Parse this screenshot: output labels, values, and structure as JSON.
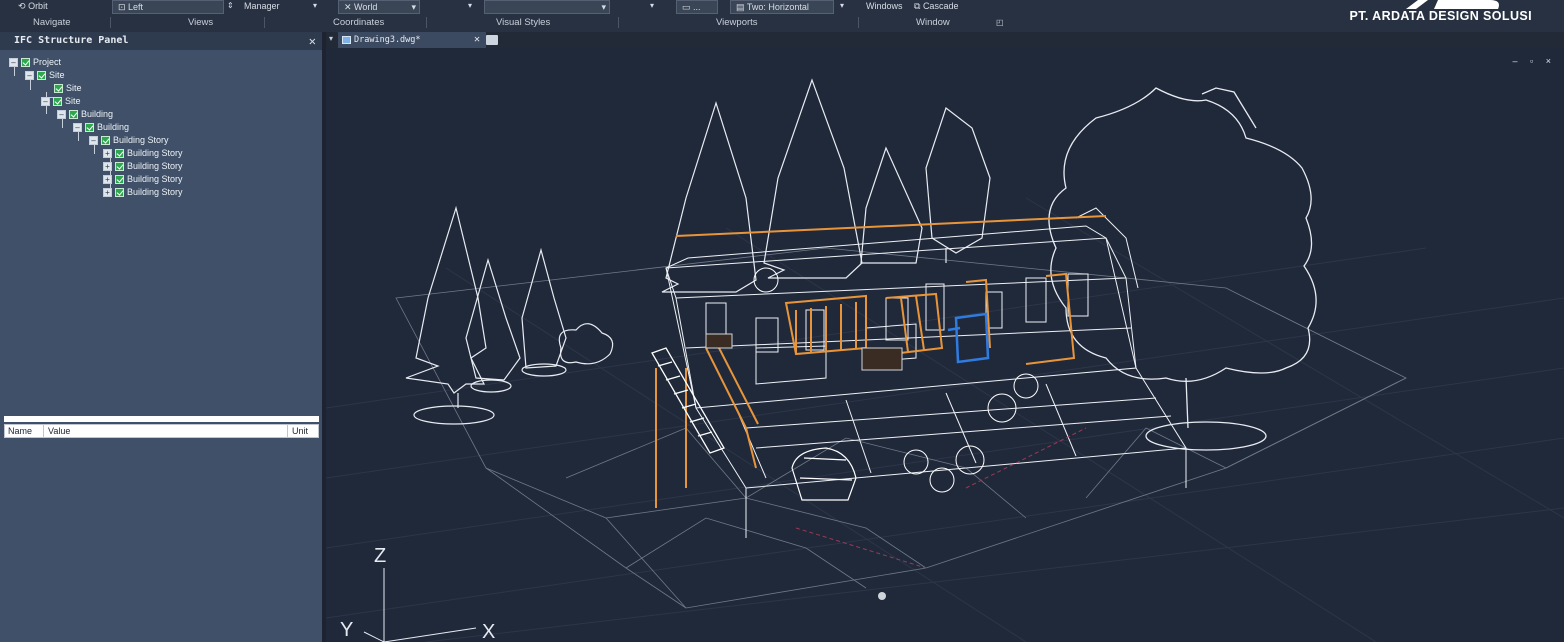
{
  "ribbon": {
    "orbit_label": "Orbit",
    "view_select": "Left",
    "manager_label": "Manager",
    "coord_select": "World",
    "visual_style_select": "",
    "viewport_btn": "...",
    "viewport_config": "Two: Horizontal",
    "windows_label": "Windows",
    "cascade_label": "Cascade",
    "groups": [
      "Navigate",
      "Views",
      "Coordinates",
      "Visual Styles",
      "Viewports",
      "Window"
    ]
  },
  "brand": {
    "name": "PT. ARDATA DESIGN SOLUSI"
  },
  "ifc_panel": {
    "title": "IFC Structure Panel",
    "tree": [
      {
        "label": "Project",
        "level": 0,
        "expander": "minus"
      },
      {
        "label": "Site",
        "level": 1,
        "expander": "minus"
      },
      {
        "label": "Site",
        "level": 2,
        "expander": "none"
      },
      {
        "label": "Site",
        "level": 2,
        "expander": "minus"
      },
      {
        "label": "Building",
        "level": 3,
        "expander": "minus"
      },
      {
        "label": "Building",
        "level": 4,
        "expander": "minus"
      },
      {
        "label": "Building Story",
        "level": 5,
        "expander": "minus"
      },
      {
        "label": "Building Story",
        "level": 6,
        "expander": "plus"
      },
      {
        "label": "Building Story",
        "level": 6,
        "expander": "plus"
      },
      {
        "label": "Building Story",
        "level": 6,
        "expander": "plus"
      },
      {
        "label": "Building Story",
        "level": 6,
        "expander": "plus"
      }
    ],
    "properties_columns": [
      "Name",
      "Value",
      "Unit"
    ]
  },
  "document": {
    "tab_title": "Drawing3.dwg*"
  },
  "viewport": {
    "win_controls": "– ▫ ×",
    "axes": {
      "z": "Z",
      "y": "Y",
      "x": "X"
    }
  },
  "colors": {
    "background": "#20293a",
    "wireframe": "#e8ecf2",
    "accent_wood": "#e8953a",
    "accent_blue": "#2f7be0"
  }
}
